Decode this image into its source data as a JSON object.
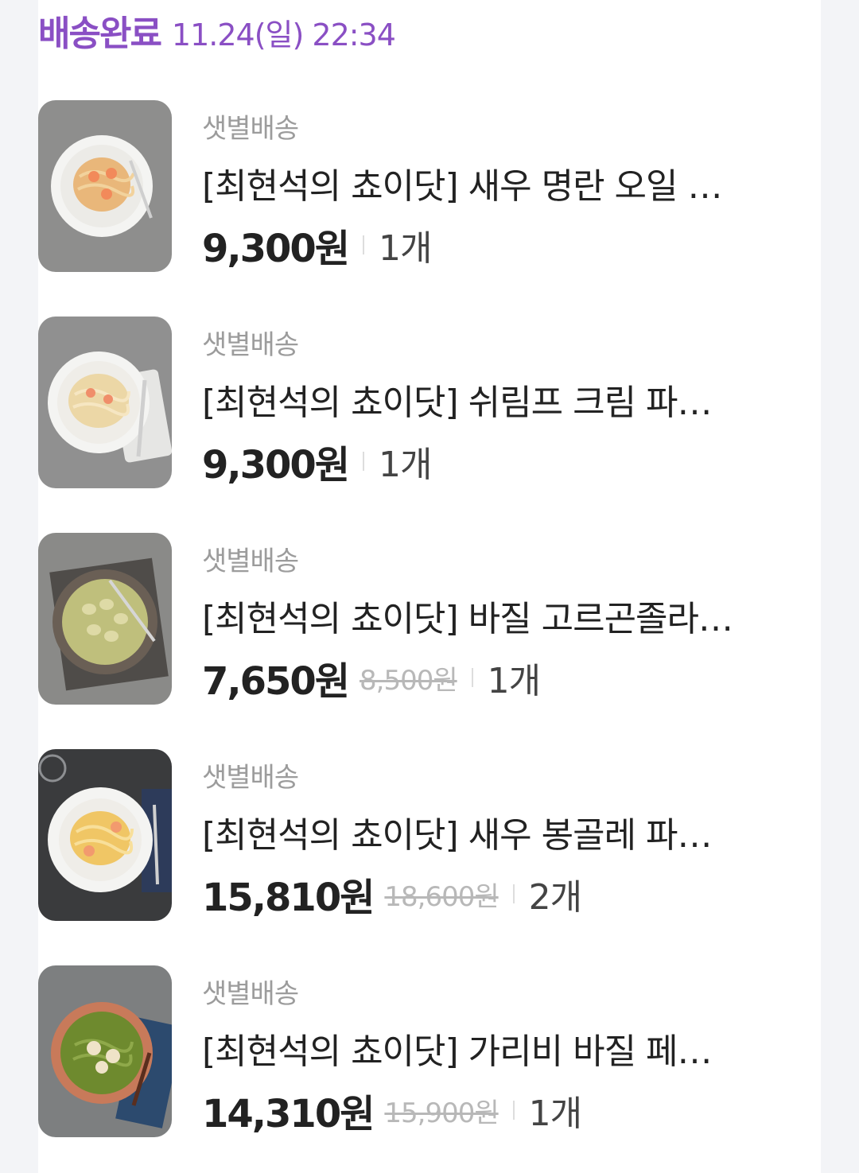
{
  "order": {
    "status": "배송완료",
    "datetime": "11.24(일) 22:34"
  },
  "colors": {
    "accent": "#8a4fc4",
    "text_primary": "#222222",
    "text_secondary": "#9c9c9c",
    "strike": "#b8b8b8",
    "background": "#f3f4f7"
  },
  "items": [
    {
      "delivery_type": "샛별배송",
      "name": "[최현석의 쵸이닷] 새우 명란 오일 파스타",
      "price": "9,300원",
      "original_price": "",
      "quantity": "1개",
      "image": "shrimp-oil-pasta-photo"
    },
    {
      "delivery_type": "샛별배송",
      "name": "[최현석의 쵸이닷] 쉬림프 크림 파스타",
      "price": "9,300원",
      "original_price": "",
      "quantity": "1개",
      "image": "shrimp-cream-pasta-photo"
    },
    {
      "delivery_type": "샛별배송",
      "name": "[최현석의 쵸이닷] 바질 고르곤졸라 뇨끼",
      "price": "7,650원",
      "original_price": "8,500원",
      "quantity": "1개",
      "image": "basil-gnocchi-photo"
    },
    {
      "delivery_type": "샛별배송",
      "name": "[최현석의 쵸이닷] 새우 봉골레 파스타",
      "price": "15,810원",
      "original_price": "18,600원",
      "quantity": "2개",
      "image": "shrimp-vongole-pasta-photo"
    },
    {
      "delivery_type": "샛별배송",
      "name": "[최현석의 쵸이닷] 가리비 바질 페스토 파스타",
      "price": "14,310원",
      "original_price": "15,900원",
      "quantity": "1개",
      "image": "scallop-basil-pasta-photo"
    }
  ]
}
